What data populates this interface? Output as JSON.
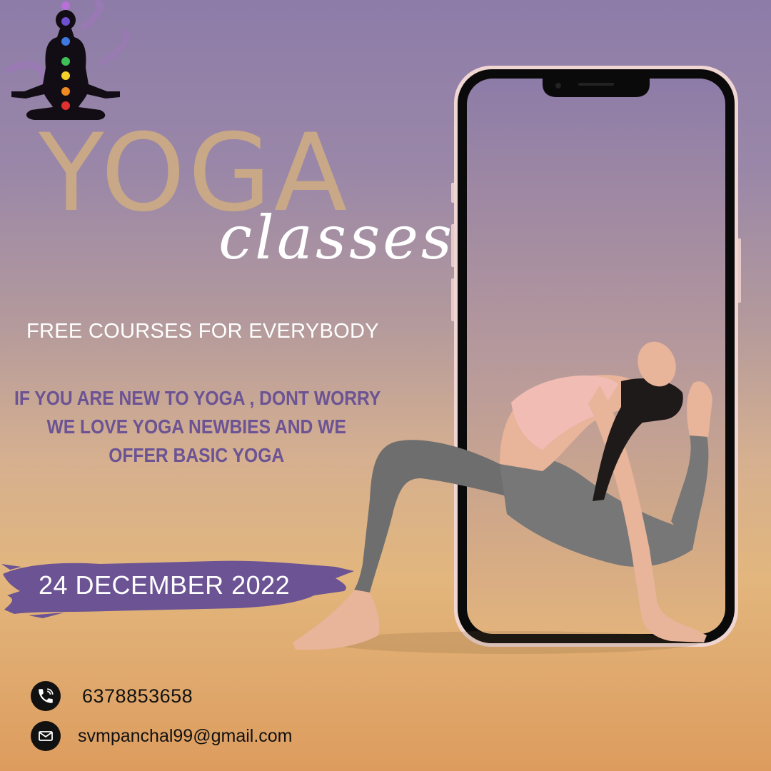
{
  "title": "YOGA",
  "subtitle": "classes",
  "tagline": "FREE COURSES FOR EVERYBODY",
  "message": [
    "IF YOU ARE NEW TO YOGA , DONT WORRY",
    "WE LOVE YOGA NEWBIES AND WE",
    "OFFER BASIC YOGA"
  ],
  "event_date": "24 DECEMBER 2022",
  "contact": {
    "phone": "6378853658",
    "email": "svmpanchal99@gmail.com"
  },
  "icons": {
    "logo": "meditation-chakra-icon",
    "phone": "phone-icon",
    "email": "envelope-icon"
  },
  "colors": {
    "title": "#c8a886",
    "message": "#6b5394",
    "date_banner": "#6b5394",
    "background_top": "#8d7ca8",
    "background_bottom": "#dd9c5e"
  }
}
